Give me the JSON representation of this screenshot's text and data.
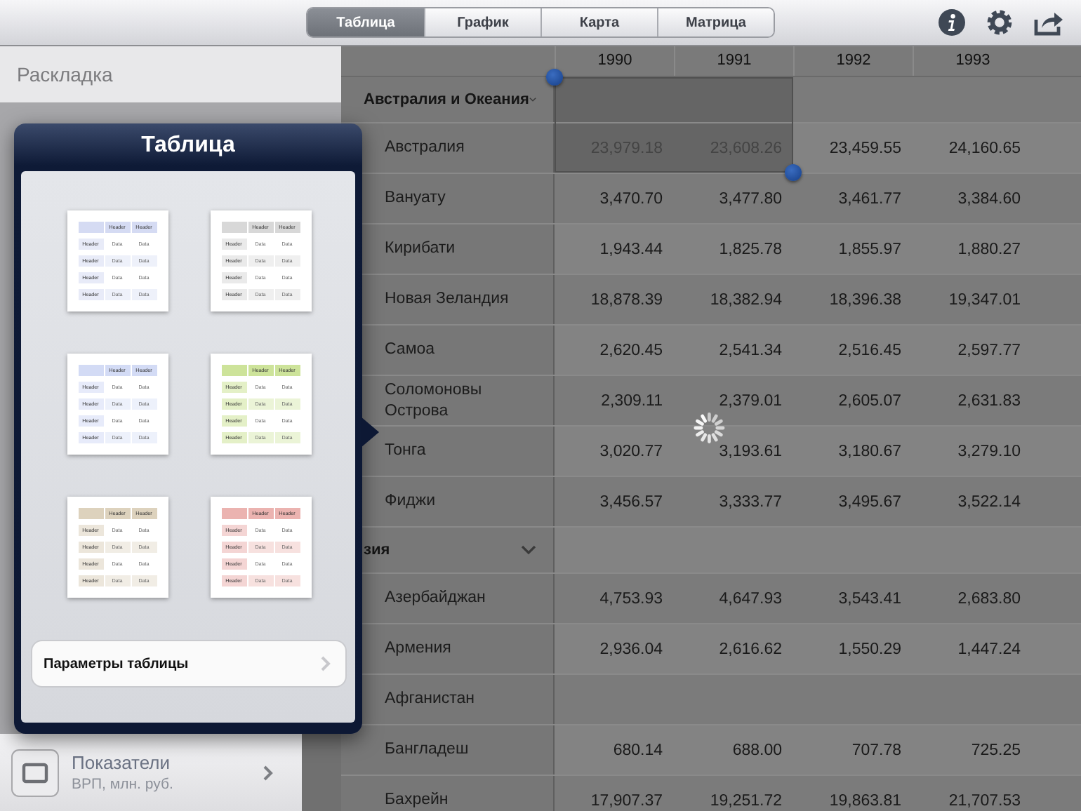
{
  "toolbar": {
    "tabs": [
      {
        "label": "Таблица",
        "selected": true
      },
      {
        "label": "График",
        "selected": false
      },
      {
        "label": "Карта",
        "selected": false
      },
      {
        "label": "Матрица",
        "selected": false
      }
    ]
  },
  "sidebar": {
    "title": "Раскладка",
    "items": [
      {
        "title": "Показатели",
        "subtitle": "ВРП, млн. руб."
      }
    ]
  },
  "popover": {
    "title": "Таблица",
    "styles": [
      {
        "color": "#d5dbf3",
        "headers": [
          "Header",
          "Header"
        ],
        "rows": [
          {
            "header": "Header",
            "data": [
              "Data",
              "Data"
            ]
          },
          {
            "header": "Header",
            "data": [
              "Data",
              "Data"
            ]
          },
          {
            "header": "Header",
            "data": [
              "Data",
              "Data"
            ]
          },
          {
            "header": "Header",
            "data": [
              "Data",
              "Data"
            ]
          }
        ]
      },
      {
        "color": "#d8d8d8",
        "headers": [
          "Header",
          "Header"
        ],
        "rows": [
          {
            "header": "Header",
            "data": [
              "Data",
              "Data"
            ]
          },
          {
            "header": "Header",
            "data": [
              "Data",
              "Data"
            ]
          },
          {
            "header": "Header",
            "data": [
              "Data",
              "Data"
            ]
          },
          {
            "header": "Header",
            "data": [
              "Data",
              "Data"
            ]
          }
        ]
      },
      {
        "color": "#d3dbf5",
        "headers": [
          "Header",
          "Header"
        ],
        "rows": [
          {
            "header": "Header",
            "data": [
              "Data",
              "Data"
            ]
          },
          {
            "header": "Header",
            "data": [
              "Data",
              "Data"
            ]
          },
          {
            "header": "Header",
            "data": [
              "Data",
              "Data"
            ]
          },
          {
            "header": "Header",
            "data": [
              "Data",
              "Data"
            ]
          }
        ]
      },
      {
        "color": "#cde39a",
        "headers": [
          "Header",
          "Header"
        ],
        "rows": [
          {
            "header": "Header",
            "data": [
              "Data",
              "Data"
            ]
          },
          {
            "header": "Header",
            "data": [
              "Data",
              "Data"
            ]
          },
          {
            "header": "Header",
            "data": [
              "Data",
              "Data"
            ]
          },
          {
            "header": "Header",
            "data": [
              "Data",
              "Data"
            ]
          }
        ]
      },
      {
        "color": "#ddd2bd",
        "headers": [
          "Header",
          "Header"
        ],
        "rows": [
          {
            "header": "Header",
            "data": [
              "Data",
              "Data"
            ]
          },
          {
            "header": "Header",
            "data": [
              "Data",
              "Data"
            ]
          },
          {
            "header": "Header",
            "data": [
              "Data",
              "Data"
            ]
          },
          {
            "header": "Header",
            "data": [
              "Data",
              "Data"
            ]
          }
        ]
      },
      {
        "color": "#ebb3b0",
        "headers": [
          "Header",
          "Header"
        ],
        "rows": [
          {
            "header": "Header",
            "data": [
              "Data",
              "Data"
            ]
          },
          {
            "header": "Header",
            "data": [
              "Data",
              "Data"
            ]
          },
          {
            "header": "Header",
            "data": [
              "Data",
              "Data"
            ]
          },
          {
            "header": "Header",
            "data": [
              "Data",
              "Data"
            ]
          }
        ]
      }
    ],
    "button": "Параметры таблицы"
  },
  "table": {
    "columns": [
      "1990",
      "1991",
      "1992",
      "1993"
    ],
    "groups": [
      {
        "label": "Австралия и Океания",
        "expanded": true,
        "cells": [
          {
            "selected": true
          },
          {
            "selected": true
          },
          {
            "selected": false
          },
          {
            "selected": false
          }
        ],
        "children": [
          {
            "name": "Австралия",
            "values": [
              {
                "text": "23,979.18",
                "selected": true
              },
              {
                "text": "23,608.26",
                "selected": true
              },
              {
                "text": "23,459.55",
                "selected": false
              },
              {
                "text": "24,160.65",
                "selected": false
              }
            ]
          },
          {
            "name": "Вануату",
            "values": [
              {
                "text": "3,470.70",
                "selected": false
              },
              {
                "text": "3,477.80",
                "selected": false
              },
              {
                "text": "3,461.77",
                "selected": false
              },
              {
                "text": "3,384.60",
                "selected": false
              }
            ]
          },
          {
            "name": "Кирибати",
            "values": [
              {
                "text": "1,943.44",
                "selected": false
              },
              {
                "text": "1,825.78",
                "selected": false
              },
              {
                "text": "1,855.97",
                "selected": false
              },
              {
                "text": "1,880.27",
                "selected": false
              }
            ]
          },
          {
            "name": "Новая Зеландия",
            "values": [
              {
                "text": "18,878.39",
                "selected": false
              },
              {
                "text": "18,382.94",
                "selected": false
              },
              {
                "text": "18,396.38",
                "selected": false
              },
              {
                "text": "19,347.01",
                "selected": false
              }
            ]
          },
          {
            "name": "Самоа",
            "values": [
              {
                "text": "2,620.45",
                "selected": false
              },
              {
                "text": "2,541.34",
                "selected": false
              },
              {
                "text": "2,516.45",
                "selected": false
              },
              {
                "text": "2,597.77",
                "selected": false
              }
            ]
          },
          {
            "name": "Соломоновы Острова",
            "values": [
              {
                "text": "2,309.11",
                "selected": false
              },
              {
                "text": "2,379.01",
                "selected": false
              },
              {
                "text": "2,605.07",
                "selected": false
              },
              {
                "text": "2,631.83",
                "selected": false
              }
            ]
          },
          {
            "name": "Тонга",
            "values": [
              {
                "text": "3,020.77",
                "selected": false
              },
              {
                "text": "3,193.61",
                "selected": false
              },
              {
                "text": "3,180.67",
                "selected": false
              },
              {
                "text": "3,279.10",
                "selected": false
              }
            ]
          },
          {
            "name": "Фиджи",
            "values": [
              {
                "text": "3,456.57",
                "selected": false
              },
              {
                "text": "3,333.77",
                "selected": false
              },
              {
                "text": "3,495.67",
                "selected": false
              },
              {
                "text": "3,522.14",
                "selected": false
              }
            ]
          }
        ]
      },
      {
        "label": "зия",
        "expanded": true,
        "cells": [
          {
            "selected": false
          },
          {
            "selected": false
          },
          {
            "selected": false
          },
          {
            "selected": false
          }
        ],
        "children": [
          {
            "name": "Азербайджан",
            "values": [
              {
                "text": "4,753.93",
                "selected": false
              },
              {
                "text": "4,647.93",
                "selected": false
              },
              {
                "text": "3,543.41",
                "selected": false
              },
              {
                "text": "2,683.80",
                "selected": false
              }
            ]
          },
          {
            "name": "Армения",
            "values": [
              {
                "text": "2,936.04",
                "selected": false
              },
              {
                "text": "2,616.62",
                "selected": false
              },
              {
                "text": "1,550.29",
                "selected": false
              },
              {
                "text": "1,447.24",
                "selected": false
              }
            ]
          },
          {
            "name": "Афганистан",
            "values": [
              {
                "selected": false
              },
              {
                "selected": false
              },
              {
                "selected": false
              },
              {
                "selected": false
              }
            ]
          },
          {
            "name": "Бангладеш",
            "values": [
              {
                "text": "680.14",
                "selected": false
              },
              {
                "text": "688.00",
                "selected": false
              },
              {
                "text": "707.78",
                "selected": false
              },
              {
                "text": "725.25",
                "selected": false
              }
            ]
          },
          {
            "name": "Бахрейн",
            "values": [
              {
                "text": "17,907.37",
                "selected": false
              },
              {
                "text": "19,251.72",
                "selected": false
              },
              {
                "text": "19,863.81",
                "selected": false
              },
              {
                "text": "21,707.53",
                "selected": false
              }
            ]
          }
        ]
      }
    ]
  }
}
